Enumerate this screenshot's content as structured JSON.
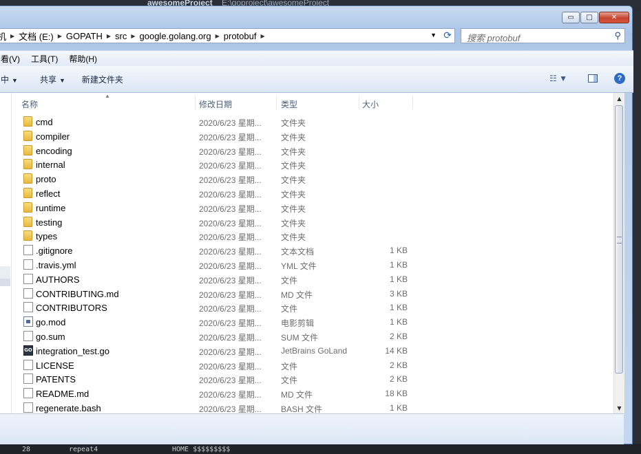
{
  "background": {
    "title": "awesomeProject",
    "path": "E:\\goproject\\awesomeProject",
    "bottom_left": "28",
    "bottom_mid": "repeat4",
    "bottom_right": "HOME $$$$$$$$$"
  },
  "window": {
    "caption_buttons": {
      "minimize": "▭",
      "maximize": "□",
      "close": "✕"
    }
  },
  "address_bar": {
    "crumbs": [
      "机",
      "文档 (E:)",
      "GOPATH",
      "src",
      "google.golang.org",
      "protobuf"
    ],
    "separator": "▶",
    "dropdown": "▼",
    "refresh": "⟳"
  },
  "search": {
    "placeholder": "搜索 protobuf",
    "icon": "search-icon"
  },
  "menu": [
    "看(V)",
    "工具(T)",
    "帮助(H)"
  ],
  "toolbar": {
    "organize": "中",
    "share": "共享",
    "new_folder": "新建文件夹",
    "view_icon": "☷",
    "help": "?"
  },
  "columns": {
    "name": "名称",
    "date": "修改日期",
    "type": "类型",
    "size": "大小"
  },
  "files": [
    {
      "name": "cmd",
      "date": "2020/6/23 星期...",
      "type": "文件夹",
      "size": "",
      "icon": "folder"
    },
    {
      "name": "compiler",
      "date": "2020/6/23 星期...",
      "type": "文件夹",
      "size": "",
      "icon": "folder"
    },
    {
      "name": "encoding",
      "date": "2020/6/23 星期...",
      "type": "文件夹",
      "size": "",
      "icon": "folder"
    },
    {
      "name": "internal",
      "date": "2020/6/23 星期...",
      "type": "文件夹",
      "size": "",
      "icon": "folder"
    },
    {
      "name": "proto",
      "date": "2020/6/23 星期...",
      "type": "文件夹",
      "size": "",
      "icon": "folder"
    },
    {
      "name": "reflect",
      "date": "2020/6/23 星期...",
      "type": "文件夹",
      "size": "",
      "icon": "folder"
    },
    {
      "name": "runtime",
      "date": "2020/6/23 星期...",
      "type": "文件夹",
      "size": "",
      "icon": "folder"
    },
    {
      "name": "testing",
      "date": "2020/6/23 星期...",
      "type": "文件夹",
      "size": "",
      "icon": "folder"
    },
    {
      "name": "types",
      "date": "2020/6/23 星期...",
      "type": "文件夹",
      "size": "",
      "icon": "folder"
    },
    {
      "name": ".gitignore",
      "date": "2020/6/23 星期...",
      "type": "文本文档",
      "size": "1 KB",
      "icon": "file"
    },
    {
      "name": ".travis.yml",
      "date": "2020/6/23 星期...",
      "type": "YML 文件",
      "size": "1 KB",
      "icon": "file"
    },
    {
      "name": "AUTHORS",
      "date": "2020/6/23 星期...",
      "type": "文件",
      "size": "1 KB",
      "icon": "file"
    },
    {
      "name": "CONTRIBUTING.md",
      "date": "2020/6/23 星期...",
      "type": "MD 文件",
      "size": "3 KB",
      "icon": "file"
    },
    {
      "name": "CONTRIBUTORS",
      "date": "2020/6/23 星期...",
      "type": "文件",
      "size": "1 KB",
      "icon": "file"
    },
    {
      "name": "go.mod",
      "date": "2020/6/23 星期...",
      "type": "电影剪辑",
      "size": "1 KB",
      "icon": "media"
    },
    {
      "name": "go.sum",
      "date": "2020/6/23 星期...",
      "type": "SUM 文件",
      "size": "2 KB",
      "icon": "file"
    },
    {
      "name": "integration_test.go",
      "date": "2020/6/23 星期...",
      "type": "JetBrains GoLand",
      "size": "14 KB",
      "icon": "go"
    },
    {
      "name": "LICENSE",
      "date": "2020/6/23 星期...",
      "type": "文件",
      "size": "2 KB",
      "icon": "file"
    },
    {
      "name": "PATENTS",
      "date": "2020/6/23 星期...",
      "type": "文件",
      "size": "2 KB",
      "icon": "file"
    },
    {
      "name": "README.md",
      "date": "2020/6/23 星期...",
      "type": "MD 文件",
      "size": "18 KB",
      "icon": "file"
    },
    {
      "name": "regenerate.bash",
      "date": "2020/6/23 星期...",
      "type": "BASH 文件",
      "size": "1 KB",
      "icon": "file"
    }
  ]
}
